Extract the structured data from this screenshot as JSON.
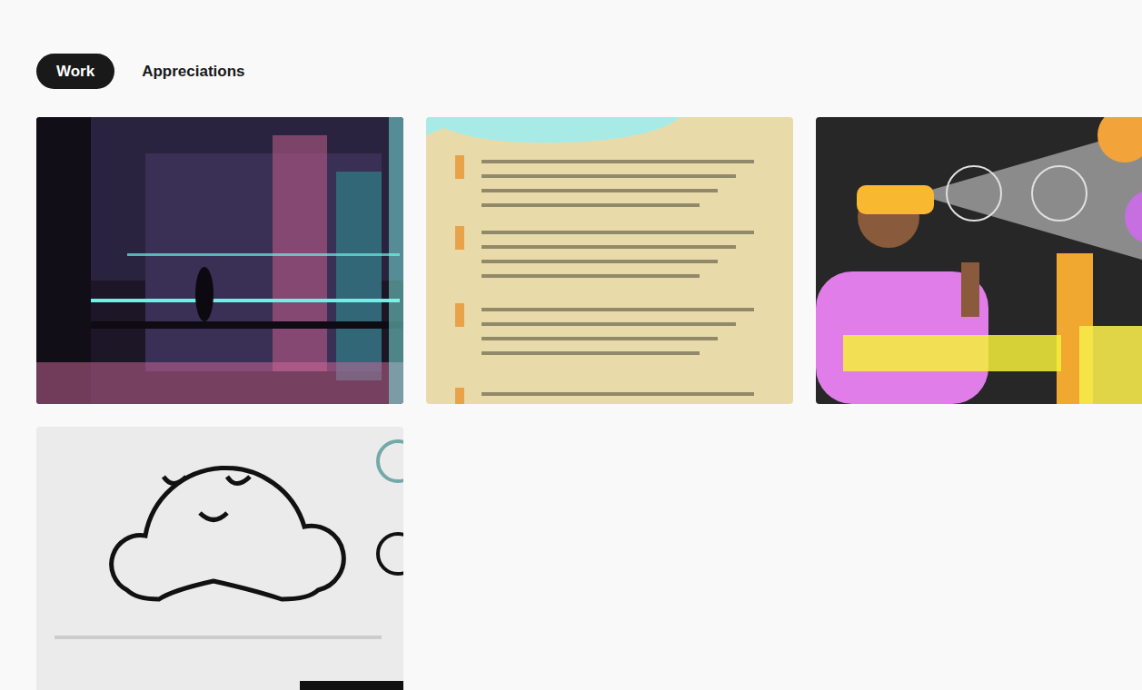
{
  "tabs": [
    {
      "label": "Work",
      "selected": true
    },
    {
      "label": "Appreciations",
      "selected": false
    }
  ],
  "projects": [
    {
      "kind": "cityscape"
    },
    {
      "kind": "document"
    },
    {
      "kind": "illustration"
    },
    {
      "kind": "logo-sheet"
    }
  ]
}
